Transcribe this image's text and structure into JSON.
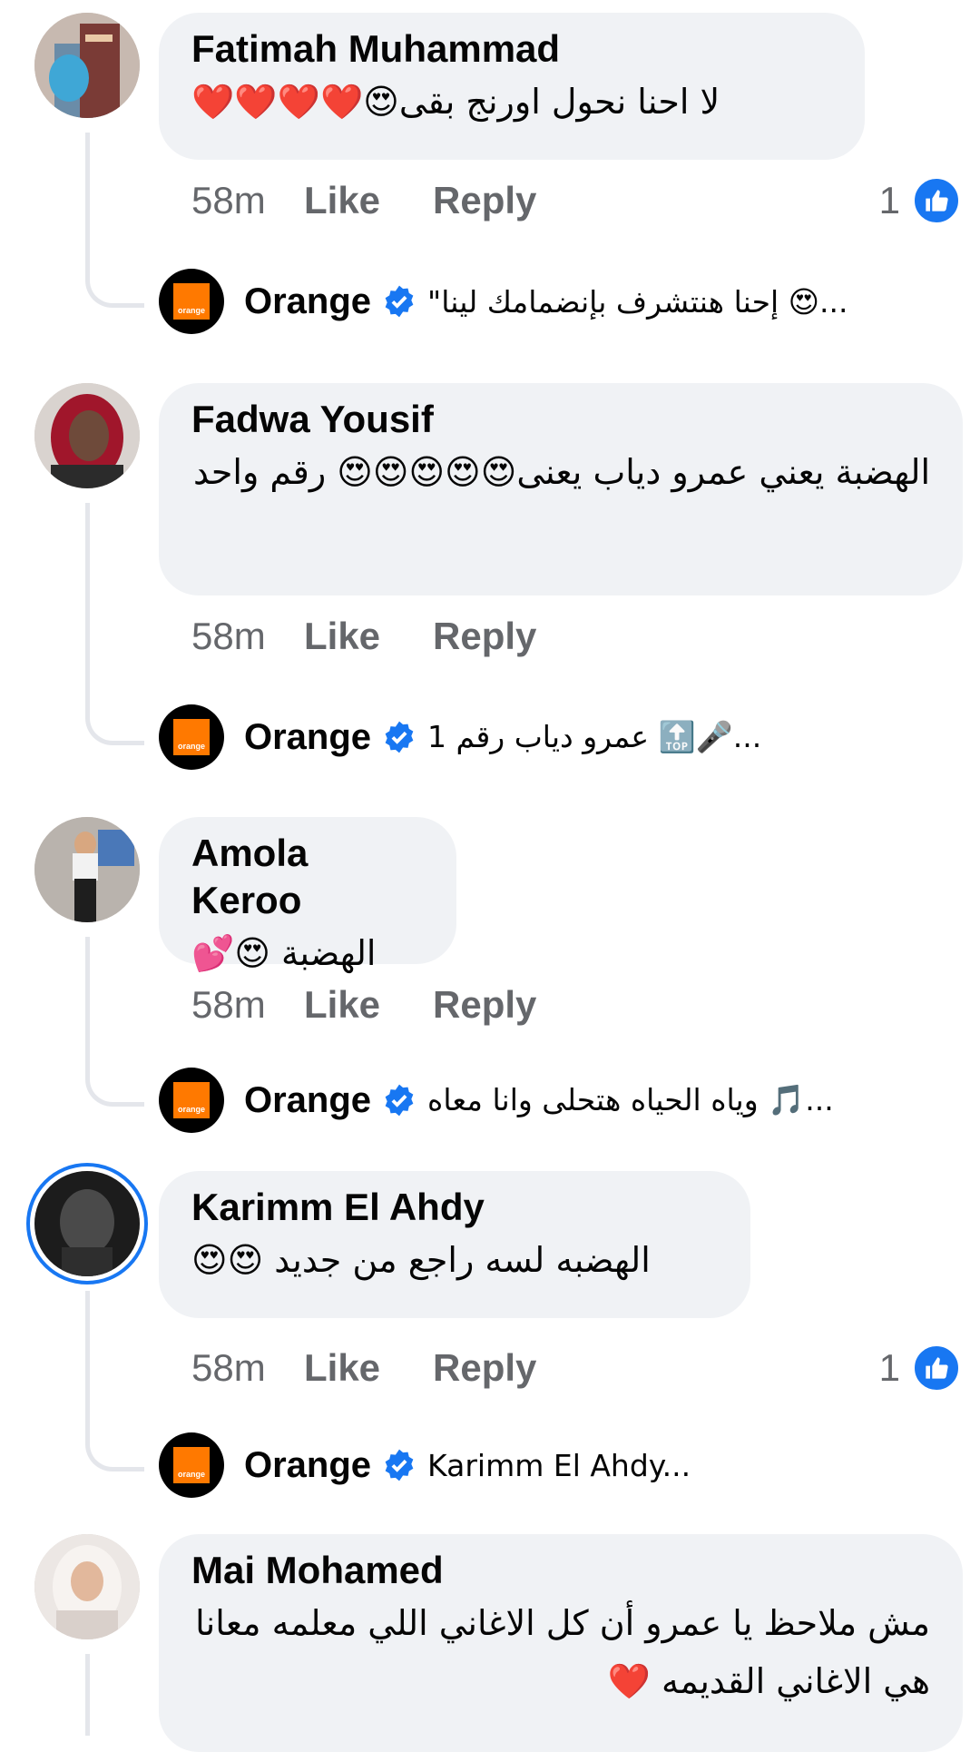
{
  "comments": [
    {
      "author": "Fatimah Muhammad",
      "text": "لا احنا نحول اورنج بقى😍❤️❤️❤️❤️",
      "time": "58m",
      "like_label": "Like",
      "reply_label": "Reply",
      "reaction_count": "1",
      "reply": {
        "author": "Orange",
        "preview": "\"إحنا هنتشرف بإنضمامك لينا 😍..."
      }
    },
    {
      "author": "Fadwa Yousif",
      "text": "الهضبة يعني عمرو دياب يعنى😍😍😍😍😍 رقم واحد",
      "time": "58m",
      "like_label": "Like",
      "reply_label": "Reply",
      "reaction_count": "",
      "reply": {
        "author": "Orange",
        "preview": "عمرو دياب رقم 1 🔝🎤..."
      }
    },
    {
      "author": "Amola Keroo",
      "text": "الهضبة 😍💕",
      "time": "58m",
      "like_label": "Like",
      "reply_label": "Reply",
      "reaction_count": "",
      "reply": {
        "author": "Orange",
        "preview": "وياه الحياه هتحلى وانا معاه 🎵..."
      }
    },
    {
      "author": "Karimm El Ahdy",
      "text": "الهضبه لسه راجع من جديد 😍😍",
      "time": "58m",
      "like_label": "Like",
      "reply_label": "Reply",
      "reaction_count": "1",
      "reply": {
        "author": "Orange",
        "preview": "Karimm El Ahdy..."
      }
    },
    {
      "author": "Mai Mohamed",
      "text": "مش ملاحظ يا عمرو أن كل الاغاني اللي معلمه معانا هي الاغاني القديمه ❤️"
    }
  ],
  "colors": {
    "bubble": "#f0f2f5",
    "secondary_text": "#65676b",
    "facebook_blue": "#1877f2",
    "orange_brand": "#ff7900"
  },
  "icons": {
    "like_badge": "thumbs-up-icon",
    "verified": "verified-badge-icon"
  }
}
